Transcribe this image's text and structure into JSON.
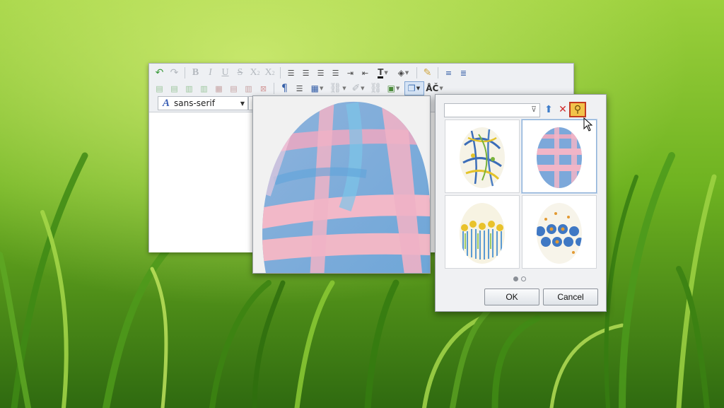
{
  "background": {
    "description_icon": "grass-wallpaper"
  },
  "editor": {
    "toolbar_row1": [
      {
        "name": "undo-icon",
        "glyph": "↶",
        "enabled": true
      },
      {
        "name": "redo-icon",
        "glyph": "↷",
        "enabled": false
      },
      {
        "name": "bold-icon",
        "glyph": "B",
        "enabled": false
      },
      {
        "name": "italic-icon",
        "glyph": "I",
        "enabled": false
      },
      {
        "name": "underline-icon",
        "glyph": "U",
        "enabled": false
      },
      {
        "name": "strikethrough-icon",
        "glyph": "S",
        "enabled": false
      },
      {
        "name": "subscript-icon",
        "glyph": "X₂",
        "enabled": false
      },
      {
        "name": "superscript-icon",
        "glyph": "X²",
        "enabled": false
      }
    ],
    "font_family": "sans-serif"
  },
  "dialog": {
    "filter_placeholder": "",
    "ok_label": "OK",
    "cancel_label": "Cancel",
    "thumbnails": [
      {
        "name": "egg-splatter",
        "selected": false
      },
      {
        "name": "egg-pink-blue-stripes",
        "selected": true
      },
      {
        "name": "egg-yellow-flowers",
        "selected": false
      },
      {
        "name": "egg-blue-dots",
        "selected": false
      }
    ],
    "page_current": 1,
    "page_count": 2
  },
  "colors": {
    "accent_selected": "#8fb1d8",
    "search_highlight": "#c23a20"
  }
}
